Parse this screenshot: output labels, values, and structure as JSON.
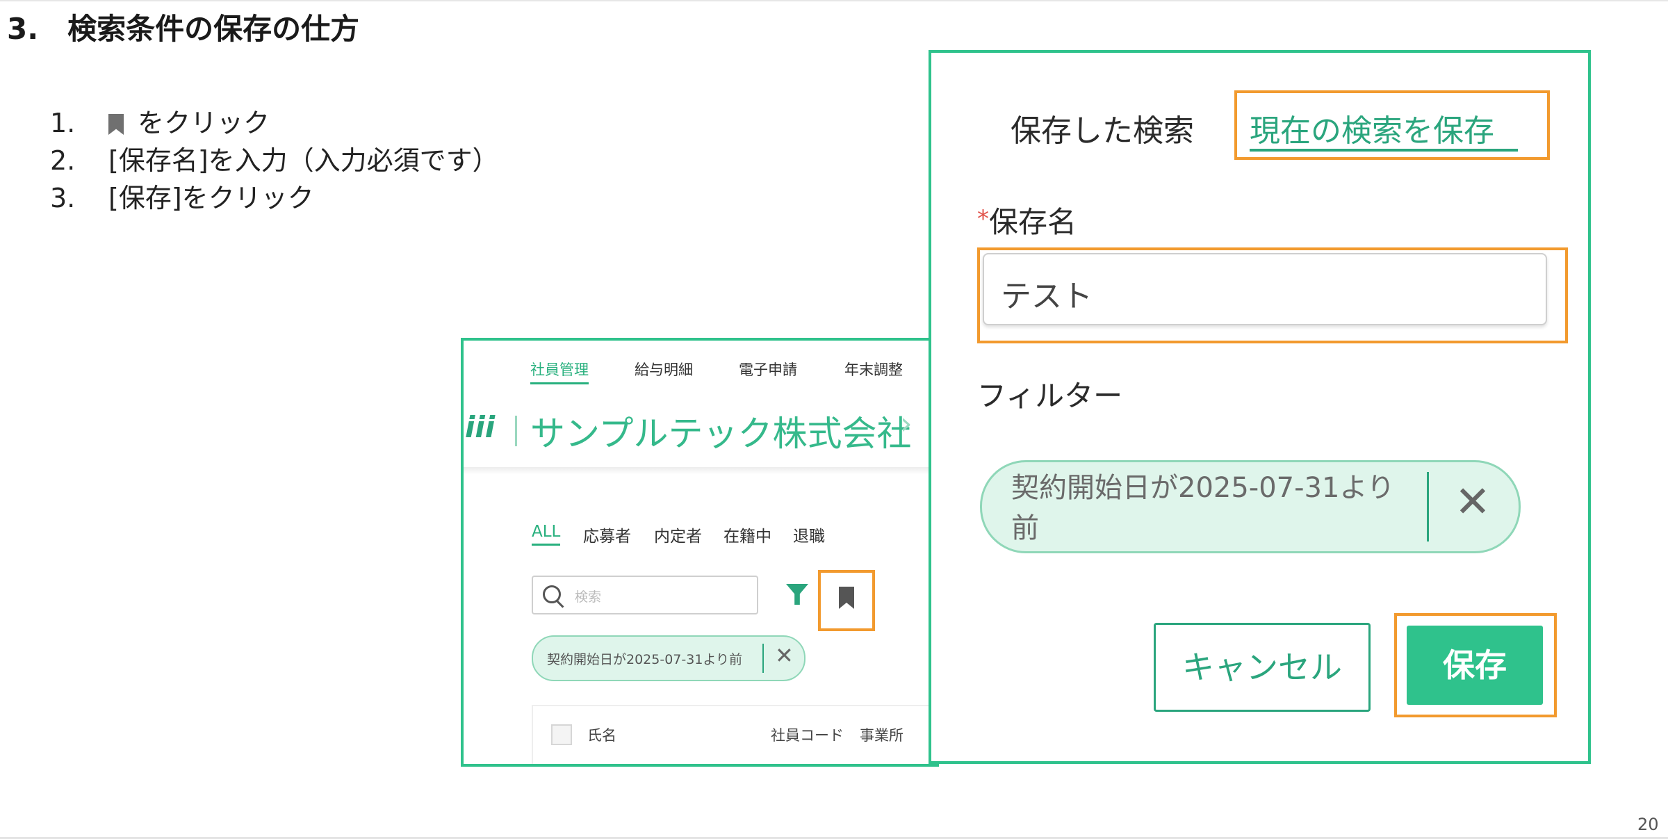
{
  "title": "3.　検索条件の保存の仕方",
  "steps": [
    {
      "num": "1.",
      "text": "をクリック"
    },
    {
      "num": "2.",
      "text": "[保存名]を入力（入力必須です）"
    },
    {
      "num": "3.",
      "text": "[保存]をクリック"
    }
  ],
  "page_number": "20",
  "app": {
    "nav_tabs": [
      "社員管理",
      "給与明細",
      "電子申請",
      "年末調整"
    ],
    "logo": "iii",
    "company_name": "サンプルテック株式会社",
    "breadcrumb_sep": "›",
    "status_tabs": [
      "ALL",
      "応募者",
      "内定者",
      "在籍中",
      "退職"
    ],
    "search_placeholder": "検索",
    "filter_chip": "契約開始日が2025-07-31より前",
    "table_headers": [
      "氏名",
      "社員コード",
      "事業所"
    ]
  },
  "dialog": {
    "tab_saved": "保存した検索",
    "tab_save_current": "現在の検索を保存",
    "required_mark": "*",
    "name_label": "保存名",
    "name_value": "テスト",
    "filter_label": "フィルター",
    "filter_chip": "契約開始日が2025-07-31より前",
    "cancel_label": "キャンセル",
    "save_label": "保存"
  },
  "colors": {
    "accent": "#2fc28c",
    "highlight": "#f29a2e",
    "chip_bg": "#dff5eb"
  },
  "icons": {
    "bookmark": "bookmark-icon",
    "search": "search-icon",
    "filter": "filter-icon",
    "close": "close-icon"
  }
}
